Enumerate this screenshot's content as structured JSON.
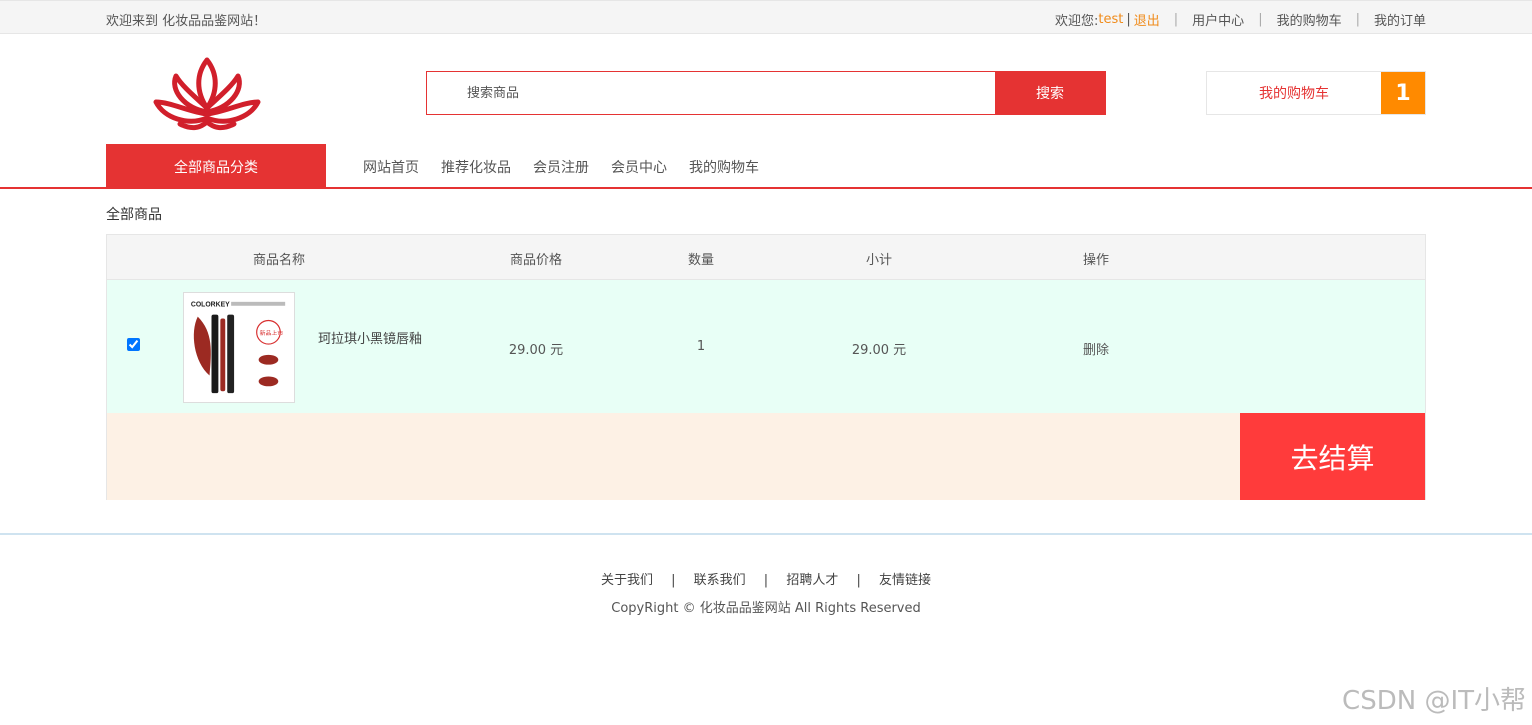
{
  "topbar": {
    "welcome": "欢迎来到 化妆品品鉴网站！",
    "greeting": "欢迎您: ",
    "username": "test",
    "logout": "退出",
    "divider": "|",
    "links": [
      "用户中心",
      "我的购物车",
      "我的订单"
    ]
  },
  "search": {
    "placeholder": "搜索商品",
    "button": "搜索"
  },
  "cart": {
    "label": "我的购物车",
    "count": "1"
  },
  "nav": {
    "all_categories": "全部商品分类",
    "items": [
      "网站首页",
      "推荐化妆品",
      "会员注册",
      "会员中心",
      "我的购物车"
    ]
  },
  "breadcrumb": "全部商品",
  "table": {
    "headers": [
      "商品名称",
      "商品价格",
      "数量",
      "小计",
      "操作"
    ],
    "rows": [
      {
        "name": "珂拉琪小黑镜唇釉",
        "price": "29.00 元",
        "quantity": "1",
        "subtotal": "29.00 元",
        "action": "删除",
        "checked": true,
        "image_text": [
          "COLORKEY",
          "新品上市"
        ]
      }
    ],
    "checkout": "去结算"
  },
  "footer": {
    "links": [
      "关于我们",
      "联系我们",
      "招聘人才",
      "友情链接"
    ],
    "divider": "|",
    "copyright": "CopyRight © 化妆品品鉴网站 All Rights Reserved"
  },
  "watermark": "CSDN @IT小帮",
  "colors": {
    "accent": "#e53333",
    "orange": "#ff8a00",
    "row_bg": "#e8fff6",
    "checkout_bg": "#ff3b3b"
  }
}
